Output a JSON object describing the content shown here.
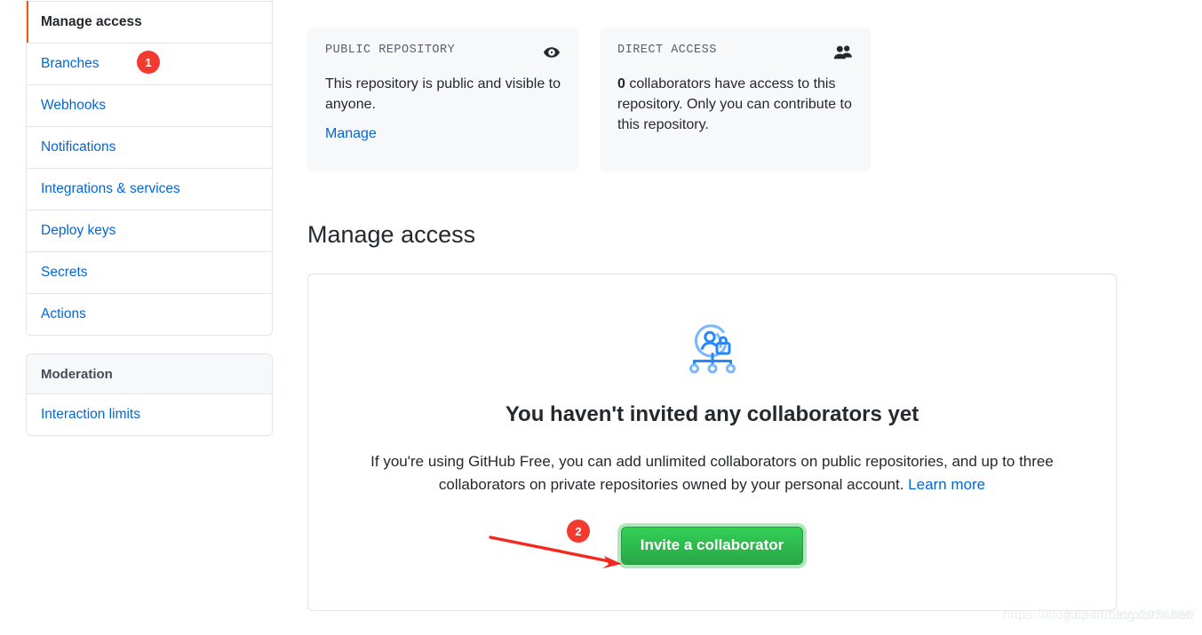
{
  "colors": {
    "link": "#0366d6",
    "accent_selected": "#e36209",
    "badge_red": "#f4392e",
    "button_green": "#28a745",
    "card_bg": "#f6f8fa",
    "border": "#e1e4e8",
    "illustration_light": "#79b8ff",
    "illustration_dark": "#2188ff"
  },
  "sidebar": {
    "primary_items": [
      {
        "label": "Manage access",
        "selected": true,
        "badge": "1"
      },
      {
        "label": "Branches",
        "selected": false
      },
      {
        "label": "Webhooks",
        "selected": false
      },
      {
        "label": "Notifications",
        "selected": false
      },
      {
        "label": "Integrations & services",
        "selected": false
      },
      {
        "label": "Deploy keys",
        "selected": false
      },
      {
        "label": "Secrets",
        "selected": false
      },
      {
        "label": "Actions",
        "selected": false
      }
    ],
    "moderation": {
      "heading": "Moderation",
      "items": [
        {
          "label": "Interaction limits"
        }
      ]
    }
  },
  "cards": [
    {
      "label": "PUBLIC REPOSITORY",
      "icon": "eye-icon",
      "body_prefix": "",
      "body_bold": "",
      "body_text": "This repository is public and visible to anyone.",
      "link": "Manage"
    },
    {
      "label": "DIRECT ACCESS",
      "icon": "people-icon",
      "body_prefix": "",
      "body_bold": "0",
      "body_text": " collaborators have access to this repository. Only you can contribute to this repository.",
      "link": ""
    }
  ],
  "main": {
    "section_title": "Manage access",
    "empty_state": {
      "illustration": "person-lock-org-chart-icon",
      "title": "You haven't invited any collaborators yet",
      "description": "If you're using GitHub Free, you can add unlimited collaborators on public repositories, and up to three collaborators on private repositories owned by your personal account.",
      "learn_more": "Learn more",
      "button": "Invite a collaborator"
    }
  },
  "annotations": {
    "badge_1": "1",
    "badge_2": "2",
    "arrow": "red-arrow-annotation"
  },
  "watermark": {
    "line1": "https://blog.csdn.net/",
    "line2": "https://blog.csdn.net/p2876860"
  }
}
